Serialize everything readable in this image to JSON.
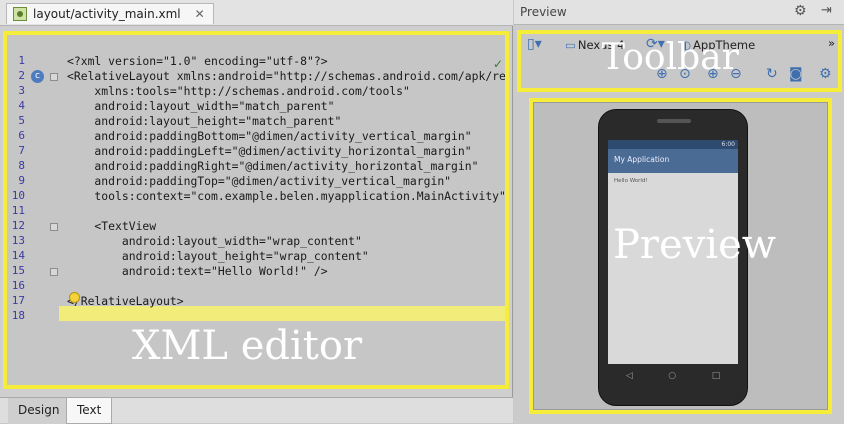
{
  "editor": {
    "file_tab": "layout/activity_main.xml",
    "line_numbers": [
      "1",
      "2",
      "3",
      "4",
      "5",
      "6",
      "7",
      "8",
      "9",
      "10",
      "11",
      "12",
      "13",
      "14",
      "15",
      "16",
      "17",
      "18"
    ],
    "code_lines": [
      "<?xml version=\"1.0\" encoding=\"utf-8\"?>",
      "<RelativeLayout xmlns:android=\"http://schemas.android.com/apk/re",
      "    xmlns:tools=\"http://schemas.android.com/tools\"",
      "    android:layout_width=\"match_parent\"",
      "    android:layout_height=\"match_parent\"",
      "    android:paddingBottom=\"@dimen/activity_vertical_margin\"",
      "    android:paddingLeft=\"@dimen/activity_horizontal_margin\"",
      "    android:paddingRight=\"@dimen/activity_horizontal_margin\"",
      "    android:paddingTop=\"@dimen/activity_vertical_margin\"",
      "    tools:context=\"com.example.belen.myapplication.MainActivity\"",
      "",
      "    <TextView",
      "        android:layout_width=\"wrap_content\"",
      "        android:layout_height=\"wrap_content\"",
      "        android:text=\"Hello World!\" />",
      "",
      "</RelativeLayout>",
      ""
    ],
    "gutter_badge": "c",
    "overlay_label": "XML editor"
  },
  "bottom_tabs": {
    "design": "Design",
    "text": "Text"
  },
  "preview": {
    "title": "Preview",
    "toolbar": {
      "device": "Nexus 4",
      "theme": "AppTheme",
      "more": "»",
      "overlay_label": "Toolbar"
    },
    "phone": {
      "status_time": "6:00",
      "app_title": "My Application",
      "text": "Hello World!"
    },
    "overlay_label": "Preview"
  },
  "icons": {
    "file": "xml-file-icon",
    "close": "close-icon",
    "gear": "gear-icon",
    "hide": "hide-panel-icon",
    "bulb": "intention-bulb-icon",
    "check": "check-icon"
  },
  "colors": {
    "highlight_frame": "#f5ed3a",
    "current_line": "#f2ec7a",
    "app_bar": "#4a6b93"
  }
}
